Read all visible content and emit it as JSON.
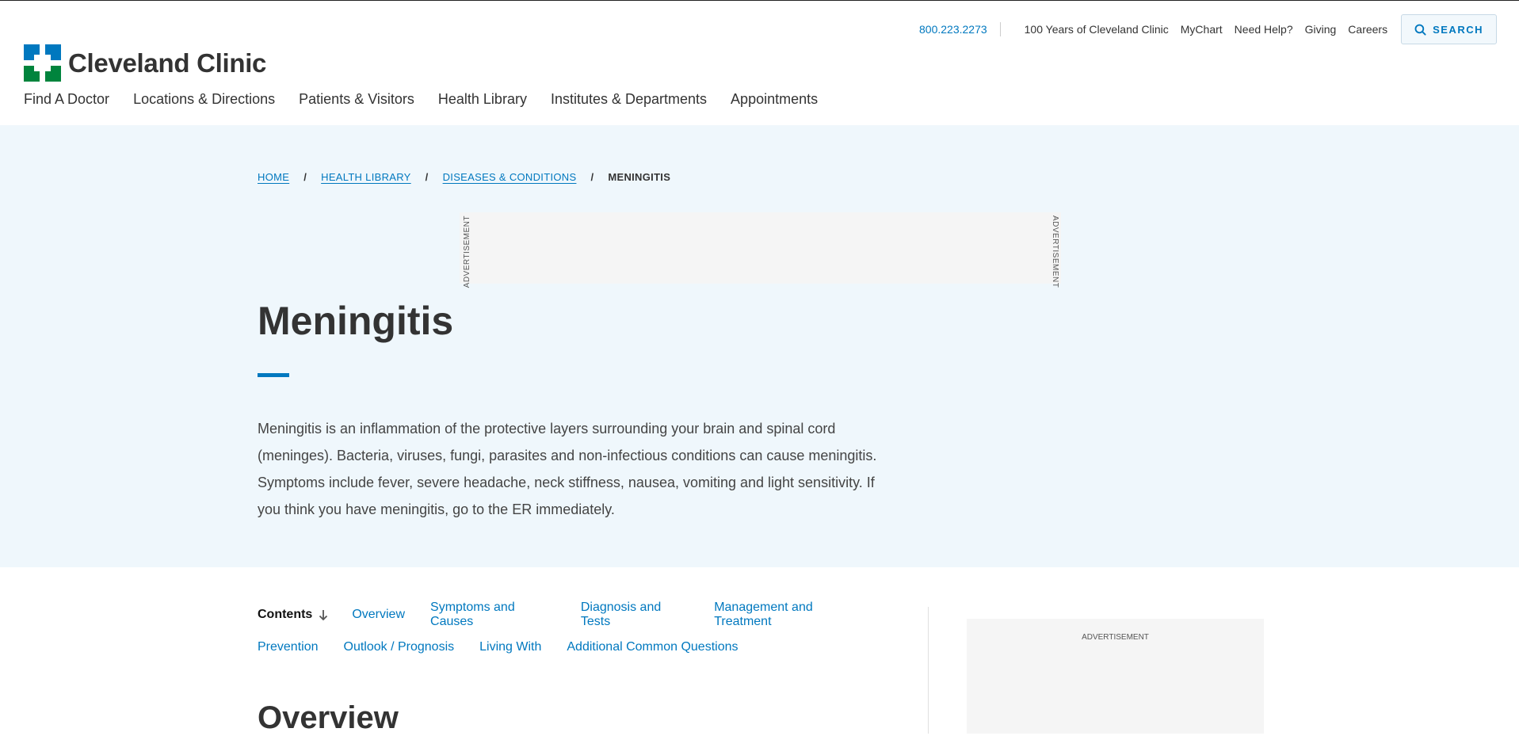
{
  "utility": {
    "phone": "800.223.2273",
    "links": [
      "100 Years of Cleveland Clinic",
      "MyChart",
      "Need Help?",
      "Giving",
      "Careers"
    ],
    "search_label": "SEARCH"
  },
  "brand": {
    "name": "Cleveland Clinic",
    "colors": {
      "blue": "#0078bf",
      "green": "#00843d"
    }
  },
  "nav": [
    "Find A Doctor",
    "Locations & Directions",
    "Patients & Visitors",
    "Health Library",
    "Institutes & Departments",
    "Appointments"
  ],
  "breadcrumb": {
    "items": [
      "HOME",
      "HEALTH LIBRARY",
      "DISEASES & CONDITIONS"
    ],
    "current": "MENINGITIS",
    "separator": "/"
  },
  "ads": {
    "label": "ADVERTISEMENT"
  },
  "article": {
    "title": "Meningitis",
    "summary": "Meningitis is an inflammation of the protective layers surrounding your brain and spinal cord (meninges). Bacteria, viruses, fungi, parasites and non-infectious conditions can cause meningitis. Symptoms include fever, severe headache, neck stiffness, nausea, vomiting and light sensitivity. If you think you have meningitis, go to the ER immediately.",
    "section_heading": "Overview"
  },
  "contents": {
    "label": "Contents",
    "row1": [
      "Overview",
      "Symptoms and Causes",
      "Diagnosis and Tests",
      "Management and Treatment"
    ],
    "row2": [
      "Prevention",
      "Outlook / Prognosis",
      "Living With",
      "Additional Common Questions"
    ]
  }
}
